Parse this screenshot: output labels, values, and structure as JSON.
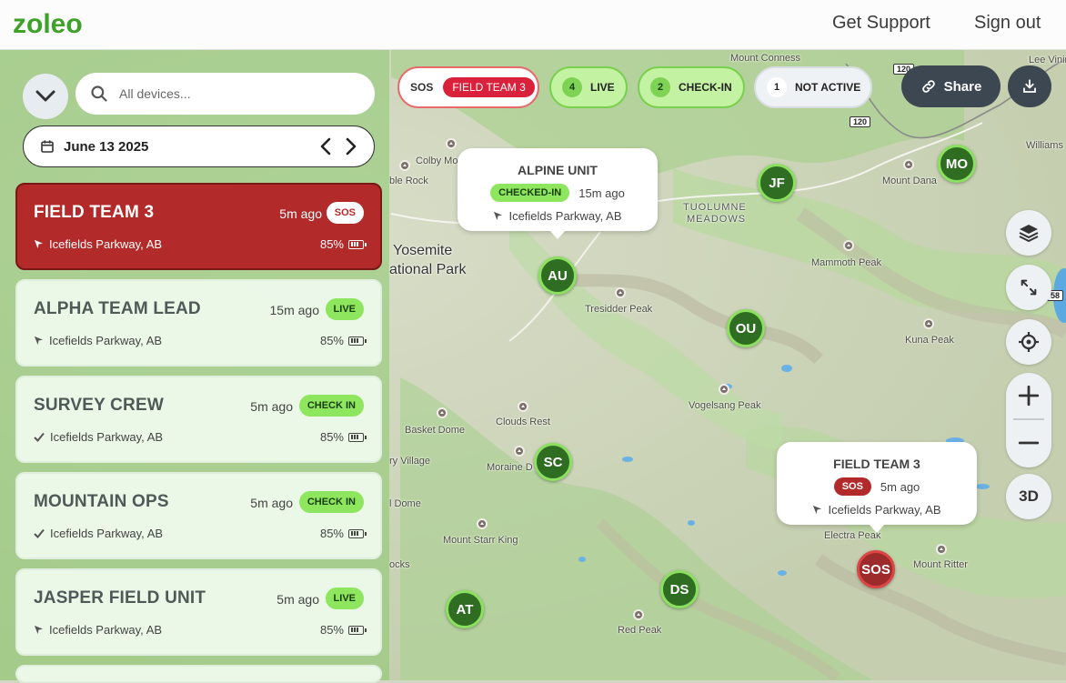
{
  "header": {
    "logo_text": "zoleo",
    "get_support": "Get Support",
    "sign_out": "Sign out"
  },
  "sidebar": {
    "search_placeholder": "All devices...",
    "date": "June 13 2025",
    "devices": [
      {
        "name": "FIELD TEAM 3",
        "time": "5m ago",
        "status": "SOS",
        "location": "Icefields Parkway, AB",
        "battery": "85%",
        "loc_icon": "navigation-arrow-icon"
      },
      {
        "name": "ALPHA TEAM LEAD",
        "time": "15m ago",
        "status": "LIVE",
        "location": "Icefields Parkway, AB",
        "battery": "85%",
        "loc_icon": "navigation-arrow-icon"
      },
      {
        "name": "SURVEY CREW",
        "time": "5m ago",
        "status": "CHECK IN",
        "location": "Icefields Parkway, AB",
        "battery": "85%",
        "loc_icon": "check-icon"
      },
      {
        "name": "MOUNTAIN OPS",
        "time": "5m ago",
        "status": "CHECK IN",
        "location": "Icefields Parkway, AB",
        "battery": "85%",
        "loc_icon": "check-icon"
      },
      {
        "name": "JASPER FIELD UNIT",
        "time": "5m ago",
        "status": "LIVE",
        "location": "Icefields Parkway, AB",
        "battery": "85%",
        "loc_icon": "navigation-arrow-icon"
      }
    ]
  },
  "filters": {
    "sos": {
      "label": "SOS",
      "pill": "FIELD TEAM 3"
    },
    "live": {
      "count": "4",
      "label": "LIVE"
    },
    "checkin": {
      "count": "2",
      "label": "CHECK-IN"
    },
    "inactive": {
      "count": "1",
      "label": "NOT ACTIVE"
    }
  },
  "toolbar": {
    "share_label": "Share",
    "three_d_label": "3D"
  },
  "map": {
    "labels": [
      "Mount Conness",
      "Lee Vining",
      "Williams",
      "Colby Mountain",
      "ble Rock",
      "Mount Dana",
      "TUOLUMNE",
      "MEADOWS",
      "Yosemite",
      "ational Park",
      "Mammoth Peak",
      "Tresidder Peak",
      "Kuna Peak",
      "Vogelsang Peak",
      "Basket Dome",
      "Clouds Rest",
      "ry Village",
      "Moraine D",
      "l Dome",
      "Mount Starr King",
      "Electra Peak",
      "Mount Ritter",
      "ocks",
      "Red Peak"
    ],
    "road_shields": [
      "120",
      "120",
      "58"
    ],
    "markers": [
      "AU",
      "JF",
      "MO",
      "OU",
      "SC",
      "DS",
      "AT",
      "SOS"
    ]
  },
  "popups": {
    "alpine": {
      "title": "ALPINE UNIT",
      "badge": "CHECKED-IN",
      "time": "15m ago",
      "location": "Icefields Parkway, AB"
    },
    "field": {
      "title": "FIELD TEAM 3",
      "badge": "SOS",
      "time": "5m ago",
      "location": "Icefields Parkway, AB"
    }
  },
  "colors": {
    "brand_green": "#3ea22a",
    "sos_red": "#b22a2a",
    "live_green": "#8ee55e",
    "dark_button": "#3c4752"
  }
}
